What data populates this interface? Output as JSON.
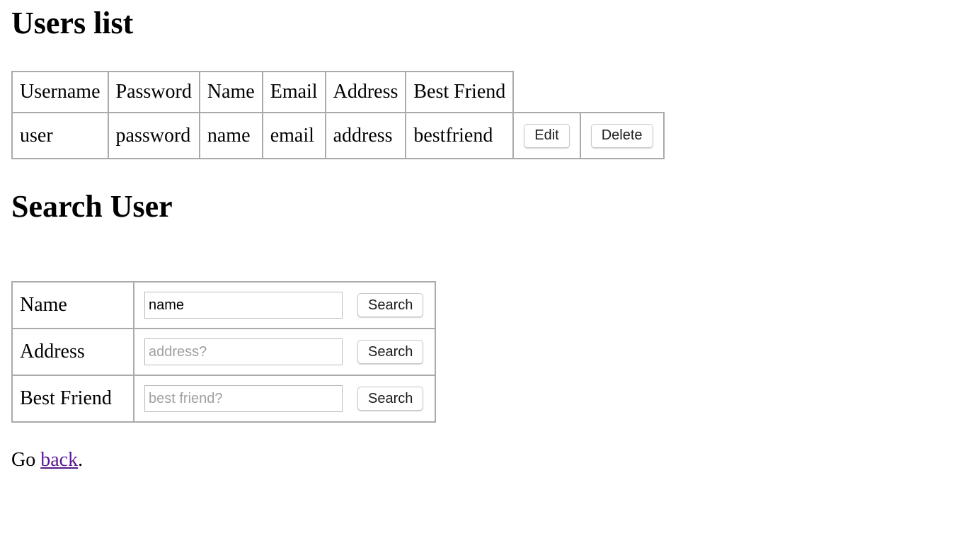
{
  "users_heading": "Users list",
  "users_table": {
    "headers": [
      "Username",
      "Password",
      "Name",
      "Email",
      "Address",
      "Best Friend"
    ],
    "row": {
      "username": "user",
      "password": "password",
      "name": "name",
      "email": "email",
      "address": "address",
      "best_friend": "bestfriend",
      "edit_label": "Edit",
      "delete_label": "Delete"
    }
  },
  "search_heading": "Search User",
  "search_form": {
    "name": {
      "label": "Name",
      "value": "name",
      "placeholder": "",
      "button_label": "Search"
    },
    "address": {
      "label": "Address",
      "value": "",
      "placeholder": "address?",
      "button_label": "Search"
    },
    "best_friend": {
      "label": "Best Friend",
      "value": "",
      "placeholder": "best friend?",
      "button_label": "Search"
    }
  },
  "footer": {
    "prefix": "Go ",
    "link_text": "back",
    "suffix": "."
  },
  "colors": {
    "link_visited": "#551a8b",
    "border": "#aaaaaa",
    "placeholder": "#a0a0a0"
  }
}
